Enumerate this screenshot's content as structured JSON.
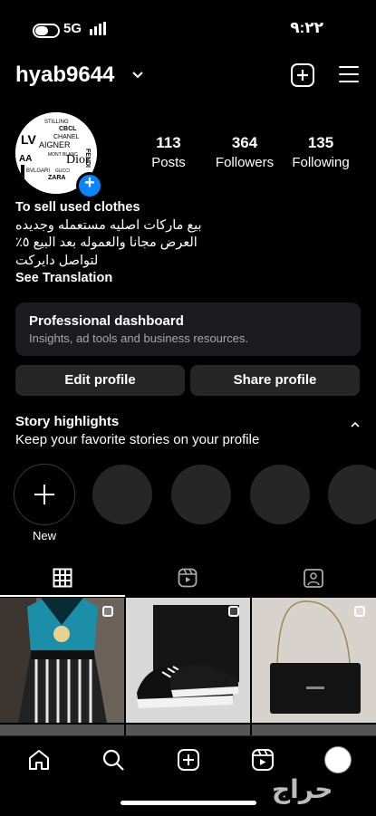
{
  "status_bar": {
    "network": "5G",
    "time": "٩:٢٢"
  },
  "header": {
    "username": "hyab9644"
  },
  "profile": {
    "avatar_brands": [
      "STILLING",
      "CBCL",
      "CHANEL",
      "AIGNER",
      "MONT BLANC",
      "BVLGARI",
      "GUCCI",
      "Dior",
      "FENDI",
      "ZARA"
    ],
    "stats": [
      {
        "value": "113",
        "label": "Posts"
      },
      {
        "value": "364",
        "label": "Followers"
      },
      {
        "value": "135",
        "label": "Following"
      }
    ],
    "bio": {
      "name": "To sell used clothes",
      "lines": [
        "بيع ماركات اصليه مستعمله وجديده",
        "العرض مجانا والعموله بعد البيع ٥٪",
        "لتواصل دايركت"
      ],
      "translate": "See Translation"
    }
  },
  "dashboard": {
    "title": "Professional dashboard",
    "subtitle": "Insights, ad tools and business resources."
  },
  "buttons": {
    "edit": "Edit profile",
    "share": "Share profile"
  },
  "highlights": {
    "title": "Story highlights",
    "subtitle": "Keep your favorite stories on your profile",
    "new_label": "New"
  },
  "tabs": [
    "grid-icon",
    "reels-icon",
    "tagged-icon"
  ],
  "nav": [
    "home-icon",
    "search-icon",
    "create-icon",
    "reels-icon",
    "profile-avatar"
  ],
  "watermark": "حراج",
  "colors": {
    "accent": "#0a84ff",
    "surface": "#262626",
    "card": "#1c1c1e"
  }
}
